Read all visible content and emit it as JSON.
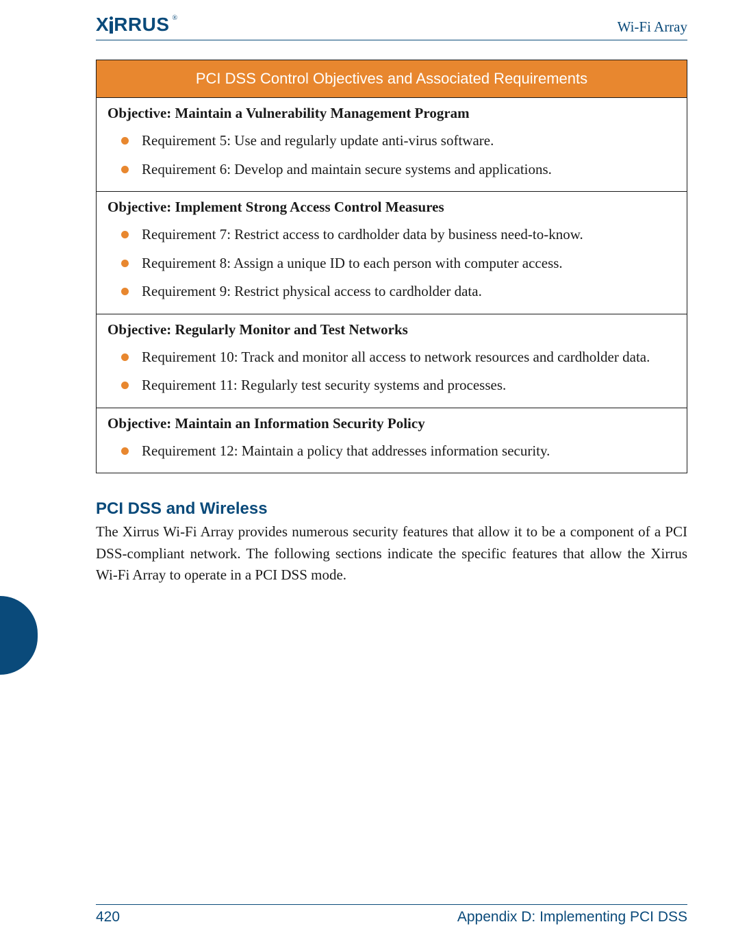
{
  "header": {
    "logo_text": "XIRRUS",
    "logo_registered": "®",
    "title": "Wi-Fi Array"
  },
  "table": {
    "title": "PCI DSS Control Objectives and Associated Requirements",
    "sections": [
      {
        "objective": "Objective: Maintain a Vulnerability Management Program",
        "requirements": [
          "Requirement 5: Use and regularly update anti-virus software.",
          "Requirement 6: Develop and maintain secure systems and applications."
        ]
      },
      {
        "objective": "Objective: Implement Strong Access Control Measures",
        "requirements": [
          "Requirement 7: Restrict access to cardholder data by business need-to-know.",
          "Requirement 8: Assign a unique ID to each person with computer access.",
          "Requirement 9: Restrict physical access to cardholder data."
        ]
      },
      {
        "objective": "Objective: Regularly Monitor and Test Networks",
        "requirements": [
          "Requirement 10: Track and monitor all access to network resources and cardholder data.",
          "Requirement 11: Regularly test security systems and processes."
        ]
      },
      {
        "objective": "Objective: Maintain an Information Security Policy",
        "requirements": [
          "Requirement 12: Maintain a policy that addresses information security."
        ]
      }
    ]
  },
  "section": {
    "heading": "PCI DSS and Wireless",
    "body": "The Xirrus Wi-Fi Array provides numerous security features that allow it to be a component of a PCI DSS-compliant network. The following sections indicate the specific features that allow the Xirrus Wi-Fi Array to operate in a PCI DSS mode."
  },
  "footer": {
    "page_number": "420",
    "appendix": "Appendix D: Implementing PCI DSS"
  }
}
